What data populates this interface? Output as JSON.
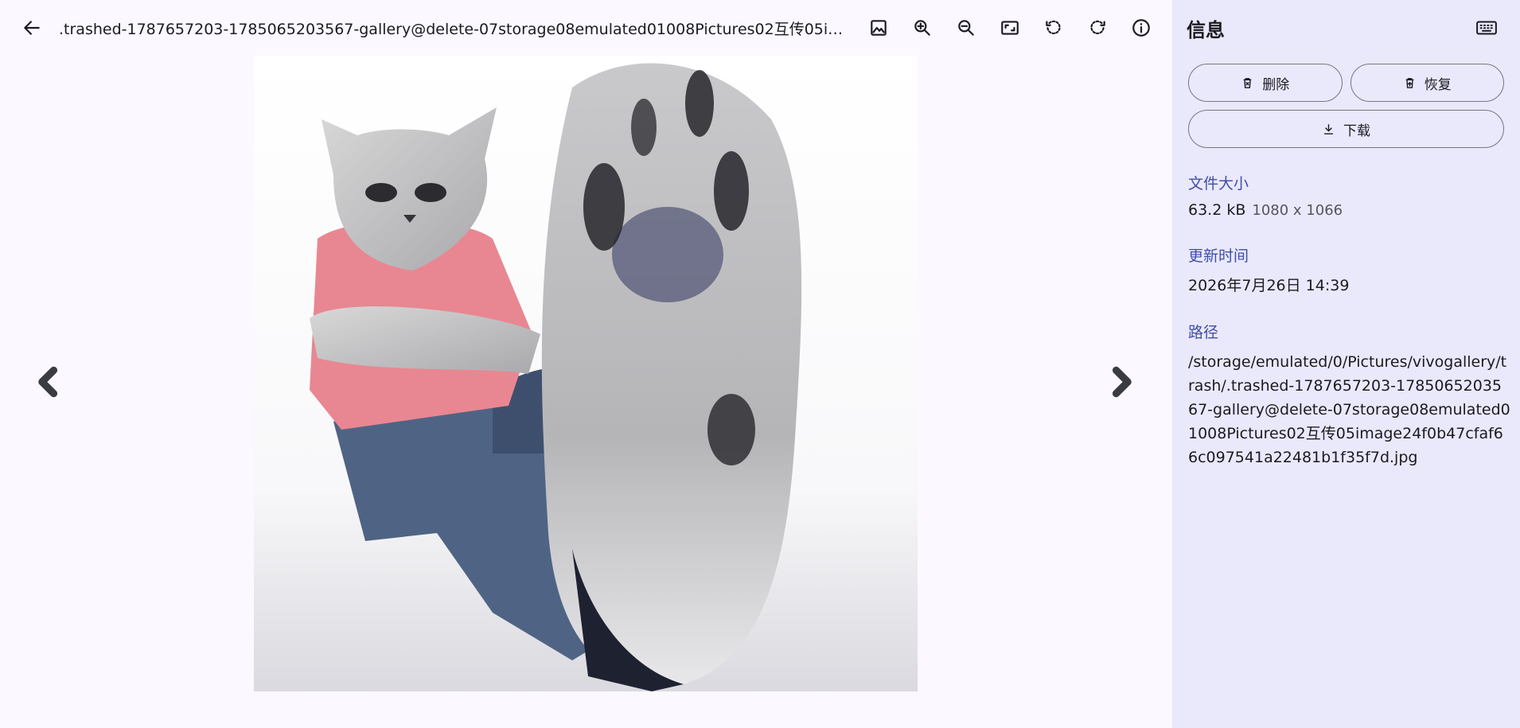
{
  "topbar": {
    "filename": ".trashed-1787657203-1785065203567-gallery@delete-07storage08emulated01008Pictures02互传05image24f0b47cfaf66c097541a22481b1f35f7d.jpg",
    "icons": [
      "image-icon",
      "zoom-in-icon",
      "zoom-out-icon",
      "fit-screen-icon",
      "rotate-left-icon",
      "rotate-right-icon",
      "info-icon"
    ]
  },
  "panel": {
    "title": "信息",
    "delete_label": "删除",
    "restore_label": "恢复",
    "download_label": "下载",
    "size_label": "文件大小",
    "size_value": "63.2 kB",
    "dimensions": "1080 x 1066",
    "updated_label": "更新时间",
    "updated_value": "2026年7月26日 14:39",
    "path_label": "路径",
    "path_value": "/storage/emulated/0/Pictures/vivogallery/trash/.trashed-1787657203-1785065203567-gallery@delete-07storage08emulated01008Pictures02互传05image24f0b47cfaf66c097541a22481b1f35f7d.jpg"
  },
  "colors": {
    "background": "#fbf8ff",
    "panel_background": "#eae8fb",
    "accent_label": "#3f4fa8"
  }
}
